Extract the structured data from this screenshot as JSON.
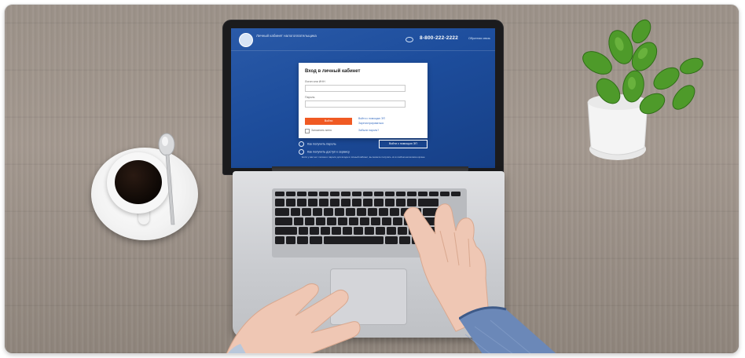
{
  "scene": {
    "description_colors": {
      "table": "#9c9289",
      "screen_blue": "#1d4d9c",
      "accent_orange": "#f05a23",
      "plant_green": "#4e9a2a"
    }
  },
  "screen": {
    "site_name": "Личный кабинет налогоплательщика",
    "phone": "8-800-222-2222",
    "help_link": "Обратная связь",
    "login_card": {
      "title": "Вход в личный кабинет",
      "login_label": "Логин или ИНН",
      "password_label": "Пароль",
      "submit_label": "Войти",
      "side_link_1": "Войти с помощью ЭП",
      "side_link_2": "Зарегистрироваться",
      "remember_label": "Запомнить меня",
      "forgot_link": "Забыли пароль?"
    },
    "row_1": "Как получить пароль",
    "row_2": "Как получить доступ к сервису",
    "esign_button": "Войти с помощью ЭП",
    "footer_text": "Если у вас нет логина и пароля для входа в личный кабинет, вы можете получить их в любом налоговом органе"
  }
}
